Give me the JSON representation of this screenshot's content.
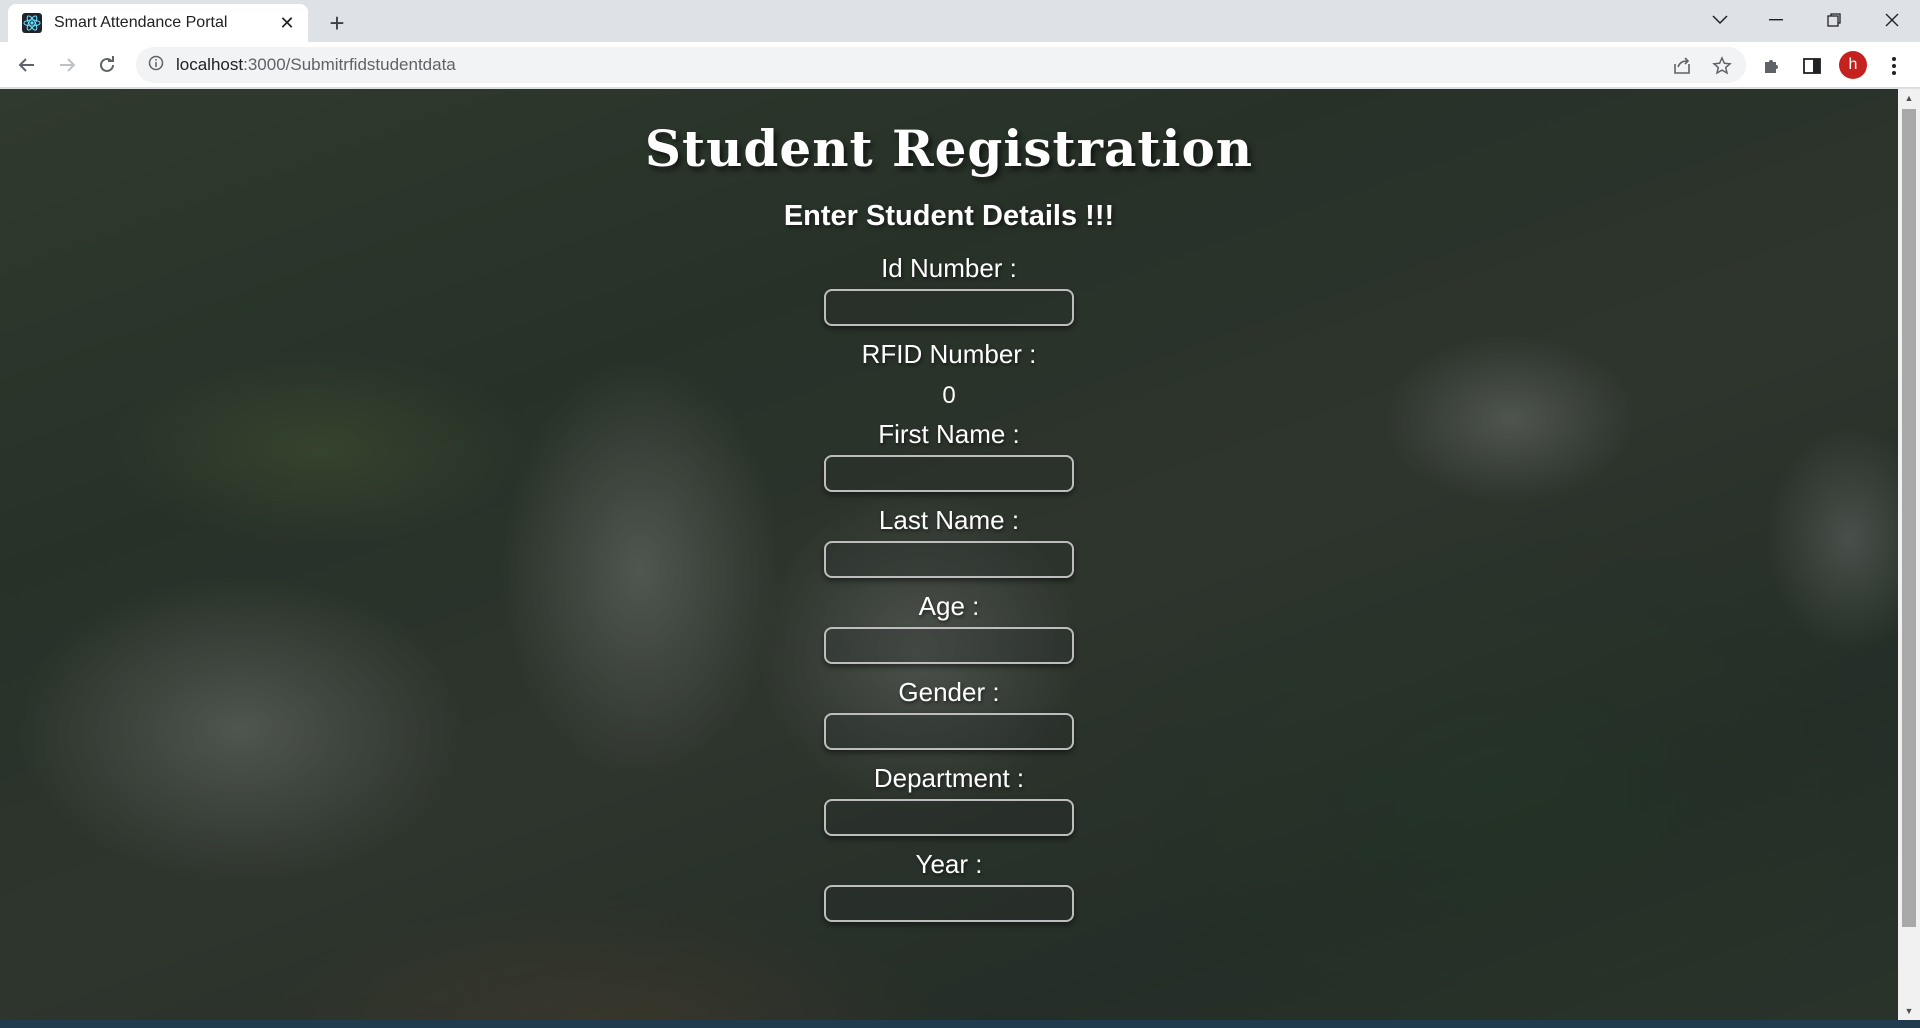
{
  "browser": {
    "tab_title": "Smart Attendance Portal",
    "url_host": "localhost",
    "url_path": ":3000/Submitrfidstudentdata",
    "profile_initial": "h"
  },
  "page": {
    "title": "Student Registration",
    "subtitle": "Enter Student Details !!!"
  },
  "form": {
    "id_label": "Id Number :",
    "rfid_label": "RFID Number :",
    "rfid_value": "0",
    "first_name_label": "First Name :",
    "last_name_label": "Last Name :",
    "age_label": "Age :",
    "gender_label": "Gender :",
    "department_label": "Department :",
    "year_label": "Year :"
  },
  "icons": {
    "favicon": "react-icon",
    "tab_close": "close-icon",
    "new_tab": "plus-icon",
    "back": "arrow-left-icon",
    "forward": "arrow-right-icon",
    "reload": "reload-icon",
    "site_info": "info-icon",
    "share": "share-icon",
    "bookmark": "star-icon",
    "extensions": "puzzle-icon",
    "side_panel": "side-panel-icon",
    "menu": "kebab-menu-icon"
  }
}
